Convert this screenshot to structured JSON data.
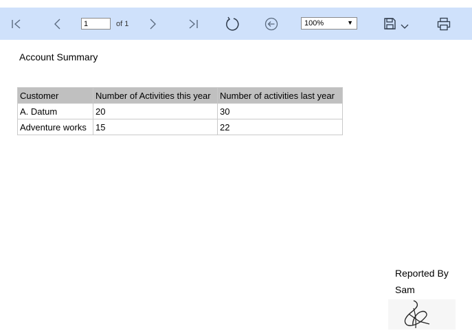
{
  "toolbar": {
    "page_value": "1",
    "of_label": "of 1",
    "zoom_value": "100%",
    "zoom_arrow": "▼",
    "icon_color": "#5b6b80",
    "background": "#cfe1fb"
  },
  "report": {
    "title": "Account Summary",
    "columns": [
      "Customer",
      "Number of Activities this year",
      "Number of activities last year"
    ],
    "rows": [
      [
        "A. Datum",
        "20",
        "30"
      ],
      [
        "Adventure works",
        "15",
        "22"
      ]
    ],
    "header_background": "#c0c0c0"
  },
  "footer": {
    "reported_by_label": "Reported By",
    "reporter_name": "Sam"
  }
}
